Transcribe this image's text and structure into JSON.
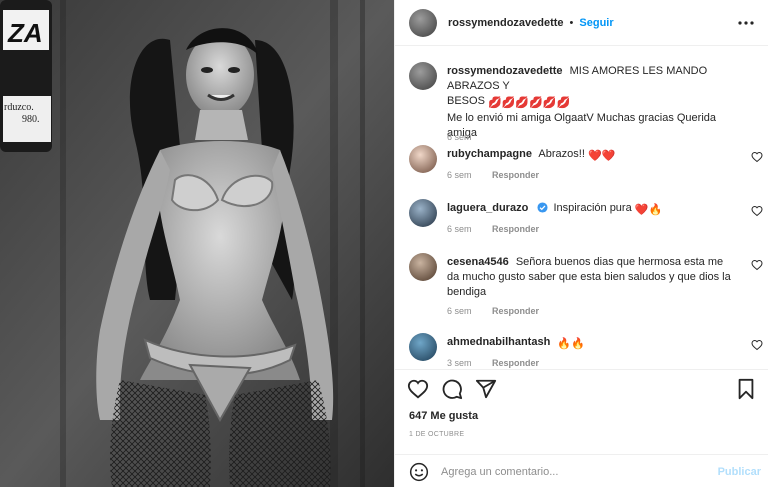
{
  "post": {
    "author": "rossymendozavedette",
    "follow_label": "Seguir",
    "dot": "•",
    "caption": {
      "username": "rossymendozavedette",
      "line1": "MIS AMORES LES MANDO ABRAZOS Y",
      "line2": "BESOS",
      "line2_emoji": "💋💋💋💋💋💋",
      "line3": "Me lo envió mi amiga OlgaatV Muchas gracias Querida amiga",
      "time": "6 sem"
    },
    "photo_text": {
      "logo_letters": "ZA",
      "credit": "rduzco.",
      "year": "980."
    }
  },
  "comments": [
    {
      "username": "rubychampagne",
      "text": "Abrazos!!",
      "emoji": "❤️❤️",
      "time": "6 sem",
      "reply": "Responder"
    },
    {
      "username": "laguera_durazo",
      "text": "Inspiración pura",
      "emoji": "❤️🔥",
      "time": "6 sem",
      "reply": "Responder"
    },
    {
      "username": "cesena4546",
      "text": "Señora buenos dias que hermosa esta me da mucho gusto saber que esta bien saludos y que dios la bendiga",
      "time": "6 sem",
      "reply": "Responder"
    },
    {
      "username": "ahmednabilhantash",
      "text": "",
      "emoji": "🔥🔥",
      "time": "3 sem",
      "reply": "Responder"
    }
  ],
  "actions": {
    "likes": "647 Me gusta",
    "date": "1 DE OCTUBRE",
    "comment_placeholder": "Agrega un comentario...",
    "publish_label": "Publicar"
  },
  "icons": {
    "more": "more-horizontal-icon",
    "like": "heart-icon",
    "comment": "comment-icon",
    "share": "share-icon",
    "save": "bookmark-icon",
    "emoji": "emoji-icon"
  },
  "colors": {
    "link_blue": "#0095f6",
    "publish_disabled": "#b2dffc",
    "muted": "#8e8e8e",
    "border": "#efefef"
  }
}
